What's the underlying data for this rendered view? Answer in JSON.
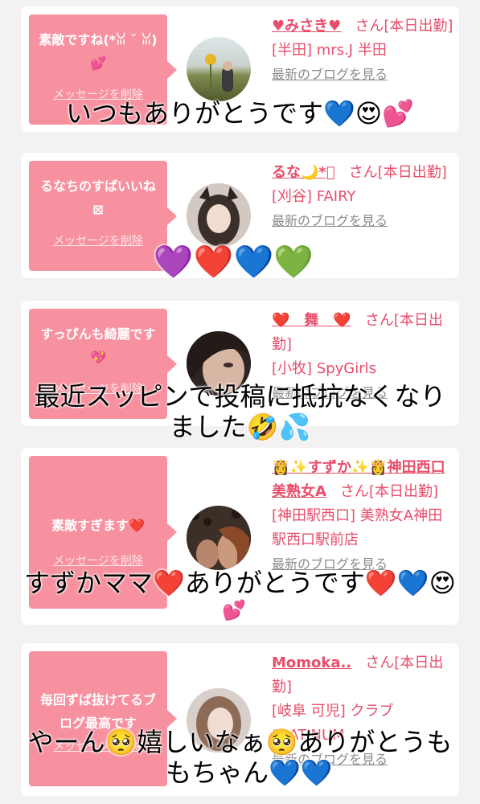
{
  "cards": [
    {
      "message": "素敵ですね(*ꈍ ˘ ꈍ)💕",
      "delete_label": "メッセージを削除",
      "name": "♥みさき♥",
      "suffix": "さん[本日出勤]",
      "shop": "[半田] mrs.J 半田",
      "blog_label": "最新のブログを見る"
    },
    {
      "message": "るなちのすぱいいね⊠",
      "delete_label": "メッセージを削除",
      "name": "るな🌙*ﾟ",
      "suffix": "さん[本日出勤]",
      "shop": "[刈谷] FAIRY",
      "blog_label": "最新のブログを見る"
    },
    {
      "message": "すっぴんも綺麗です💖",
      "delete_label": "メッセージを削除",
      "name": "❤️　舞　❤️",
      "suffix": "さん[本日出勤]",
      "shop": "[小牧] SpyGirls",
      "blog_label": "最新のブログを見る"
    },
    {
      "message": "素敵すぎます❤️",
      "delete_label": "メッセージを削除",
      "name": "👸✨すずか✨👸神田西口美熟女A",
      "suffix": "さん[本日出勤]",
      "shop": "[神田駅西口] 美熟女A神田駅西口駅前店",
      "blog_label": "最新のブログを見る"
    },
    {
      "message": "毎回ずば抜けてるブログ最高です",
      "delete_label": "メッセージを削除",
      "name": "Momoka..",
      "suffix": "さん[本日出勤]",
      "shop": "[岐阜 可児] クラブ PLATINUM",
      "blog_label": "最新のブログを見る"
    }
  ],
  "captions": {
    "c1": "いつもありがとうです💙😍💕",
    "c2": "💜❤️💙💚",
    "c3_line1": "最近スッピンで投稿に抵抗なくなり",
    "c3_line2": "ました🤣💦",
    "c4_line1": "すずかママ❤️ありがとうです❤️💙😍",
    "c4_line2": "💕",
    "c5_line1": "やーん🥺嬉しいなぁ🥺ありがとうも",
    "c5_line2": "もちゃん💙💙"
  },
  "colors": {
    "bubble": "#f7919f",
    "name": "#e84d6a",
    "blog_link": "#8b8b8b"
  }
}
